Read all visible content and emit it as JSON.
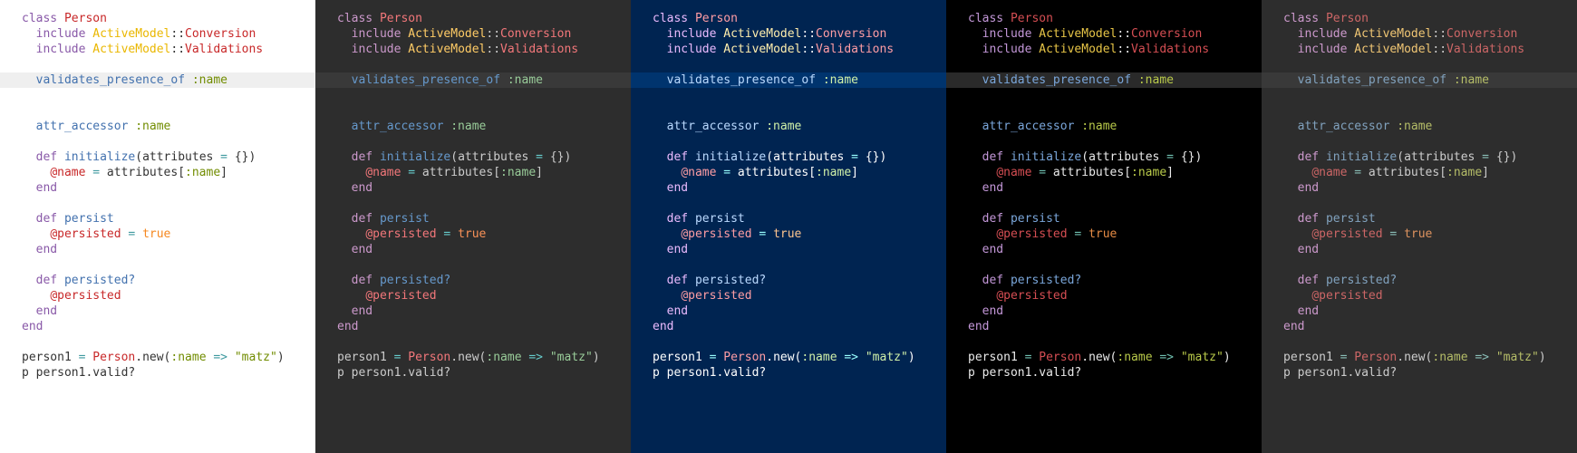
{
  "themes": [
    {
      "id": "t1",
      "background": "#ffffff",
      "highlight": "#efefef"
    },
    {
      "id": "t2",
      "background": "#2d2d2d",
      "highlight": "#393939"
    },
    {
      "id": "t3",
      "background": "#002451",
      "highlight": "#00346e"
    },
    {
      "id": "t4",
      "background": "#000000",
      "highlight": "#2a2a2a"
    },
    {
      "id": "t5",
      "background": "#2d2d2d",
      "highlight": "#393939"
    }
  ],
  "code": {
    "lines": [
      {
        "indent": 0,
        "highlight": false,
        "tokens": [
          {
            "cls": "kw",
            "text": "class"
          },
          {
            "cls": "pn",
            "text": " "
          },
          {
            "cls": "cls",
            "text": "Person"
          }
        ]
      },
      {
        "indent": 1,
        "highlight": false,
        "tokens": [
          {
            "cls": "kw",
            "text": "include"
          },
          {
            "cls": "pn",
            "text": " "
          },
          {
            "cls": "mod",
            "text": "ActiveModel"
          },
          {
            "cls": "pn",
            "text": "::"
          },
          {
            "cls": "mod2",
            "text": "Conversion"
          }
        ]
      },
      {
        "indent": 1,
        "highlight": false,
        "tokens": [
          {
            "cls": "kw",
            "text": "include"
          },
          {
            "cls": "pn",
            "text": " "
          },
          {
            "cls": "mod",
            "text": "ActiveModel"
          },
          {
            "cls": "pn",
            "text": "::"
          },
          {
            "cls": "mod2",
            "text": "Validations"
          }
        ]
      },
      {
        "indent": 0,
        "highlight": false,
        "tokens": [
          {
            "cls": "pn",
            "text": ""
          }
        ]
      },
      {
        "indent": 1,
        "highlight": true,
        "tokens": [
          {
            "cls": "fn",
            "text": "validates_presence_of"
          },
          {
            "cls": "pn",
            "text": " "
          },
          {
            "cls": "sym",
            "text": ":name"
          }
        ]
      },
      {
        "indent": 0,
        "highlight": false,
        "tokens": [
          {
            "cls": "pn",
            "text": ""
          }
        ]
      },
      {
        "indent": 1,
        "highlight": false,
        "tokens": [
          {
            "cls": "fn",
            "text": "attr_accessor"
          },
          {
            "cls": "pn",
            "text": " "
          },
          {
            "cls": "sym",
            "text": ":name"
          }
        ]
      },
      {
        "indent": 0,
        "highlight": false,
        "tokens": [
          {
            "cls": "pn",
            "text": ""
          }
        ]
      },
      {
        "indent": 1,
        "highlight": false,
        "tokens": [
          {
            "cls": "kw",
            "text": "def"
          },
          {
            "cls": "pn",
            "text": " "
          },
          {
            "cls": "fn",
            "text": "initialize"
          },
          {
            "cls": "pn",
            "text": "(attributes "
          },
          {
            "cls": "op",
            "text": "="
          },
          {
            "cls": "pn",
            "text": " {})"
          }
        ]
      },
      {
        "indent": 2,
        "highlight": false,
        "tokens": [
          {
            "cls": "ivar",
            "text": "@name"
          },
          {
            "cls": "pn",
            "text": " "
          },
          {
            "cls": "op",
            "text": "="
          },
          {
            "cls": "pn",
            "text": " attributes["
          },
          {
            "cls": "sym",
            "text": ":name"
          },
          {
            "cls": "pn",
            "text": "]"
          }
        ]
      },
      {
        "indent": 1,
        "highlight": false,
        "tokens": [
          {
            "cls": "kw",
            "text": "end"
          }
        ]
      },
      {
        "indent": 0,
        "highlight": false,
        "tokens": [
          {
            "cls": "pn",
            "text": ""
          }
        ]
      },
      {
        "indent": 1,
        "highlight": false,
        "tokens": [
          {
            "cls": "kw",
            "text": "def"
          },
          {
            "cls": "pn",
            "text": " "
          },
          {
            "cls": "fn",
            "text": "persist"
          }
        ]
      },
      {
        "indent": 2,
        "highlight": false,
        "tokens": [
          {
            "cls": "ivar",
            "text": "@persisted"
          },
          {
            "cls": "pn",
            "text": " "
          },
          {
            "cls": "op",
            "text": "="
          },
          {
            "cls": "pn",
            "text": " "
          },
          {
            "cls": "num",
            "text": "true"
          }
        ]
      },
      {
        "indent": 1,
        "highlight": false,
        "tokens": [
          {
            "cls": "kw",
            "text": "end"
          }
        ]
      },
      {
        "indent": 0,
        "highlight": false,
        "tokens": [
          {
            "cls": "pn",
            "text": ""
          }
        ]
      },
      {
        "indent": 1,
        "highlight": false,
        "tokens": [
          {
            "cls": "kw",
            "text": "def"
          },
          {
            "cls": "pn",
            "text": " "
          },
          {
            "cls": "fn",
            "text": "persisted?"
          }
        ]
      },
      {
        "indent": 2,
        "highlight": false,
        "tokens": [
          {
            "cls": "ivar",
            "text": "@persisted"
          }
        ]
      },
      {
        "indent": 1,
        "highlight": false,
        "tokens": [
          {
            "cls": "kw",
            "text": "end"
          }
        ]
      },
      {
        "indent": 0,
        "highlight": false,
        "tokens": [
          {
            "cls": "kw",
            "text": "end"
          }
        ]
      },
      {
        "indent": 0,
        "highlight": false,
        "tokens": [
          {
            "cls": "pn",
            "text": ""
          }
        ]
      },
      {
        "indent": 0,
        "highlight": false,
        "tokens": [
          {
            "cls": "pn",
            "text": "person1 "
          },
          {
            "cls": "op",
            "text": "="
          },
          {
            "cls": "pn",
            "text": " "
          },
          {
            "cls": "cls",
            "text": "Person"
          },
          {
            "cls": "pn",
            "text": ".new("
          },
          {
            "cls": "sym",
            "text": ":name"
          },
          {
            "cls": "pn",
            "text": " "
          },
          {
            "cls": "op",
            "text": "=>"
          },
          {
            "cls": "pn",
            "text": " "
          },
          {
            "cls": "str",
            "text": "\"matz\""
          },
          {
            "cls": "pn",
            "text": ")"
          }
        ]
      },
      {
        "indent": 0,
        "highlight": false,
        "tokens": [
          {
            "cls": "pn",
            "text": "p person1.valid?"
          }
        ]
      }
    ]
  }
}
